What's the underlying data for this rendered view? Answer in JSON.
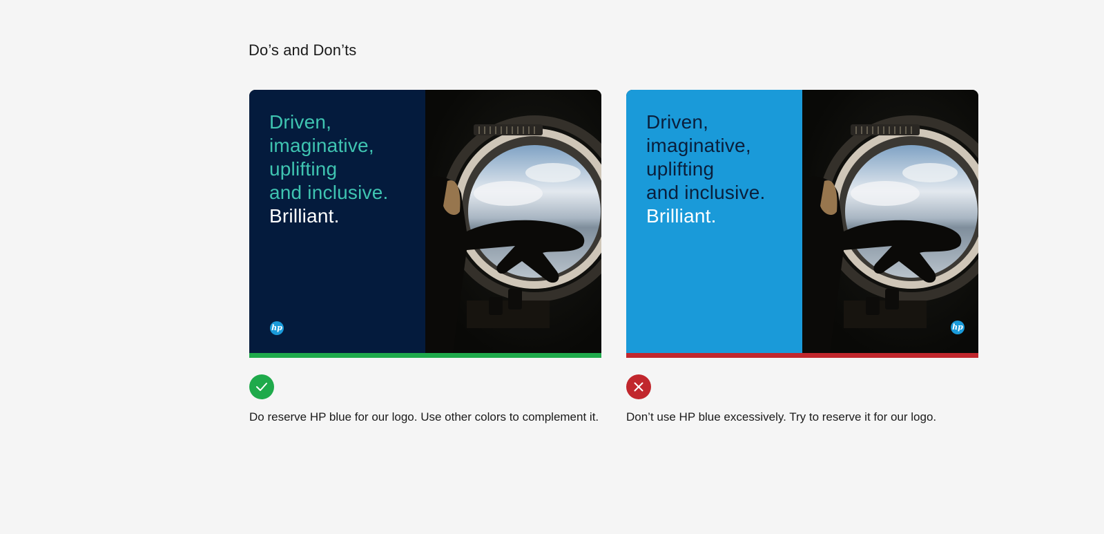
{
  "section": {
    "title": "Do’s and Don’ts"
  },
  "cards": [
    {
      "kind": "do",
      "headline_lines": [
        "Driven,",
        "imaginative,",
        "uplifting",
        "and inclusive."
      ],
      "headline_emphasis": "Brilliant.",
      "logo_text": "hp",
      "status_icon": "checkmark-icon",
      "caption": "Do reserve HP blue for our logo. Use other colors to complement it.",
      "colors": {
        "panel": "#041b3d",
        "headline": "#3fc4b1",
        "emphasis": "#ffffff",
        "bar": "#1faa4b",
        "status": "#1faa4b"
      }
    },
    {
      "kind": "dont",
      "headline_lines": [
        "Driven,",
        "imaginative,",
        "uplifting",
        "and inclusive."
      ],
      "headline_emphasis": "Brilliant.",
      "logo_text": "hp",
      "status_icon": "close-icon",
      "caption": "Don’t use HP blue excessively. Try to reserve it for our logo.",
      "colors": {
        "panel": "#1a9ad9",
        "headline": "#0a1f3c",
        "emphasis": "#ffffff",
        "bar": "#c1272d",
        "status": "#c1272d"
      }
    }
  ]
}
